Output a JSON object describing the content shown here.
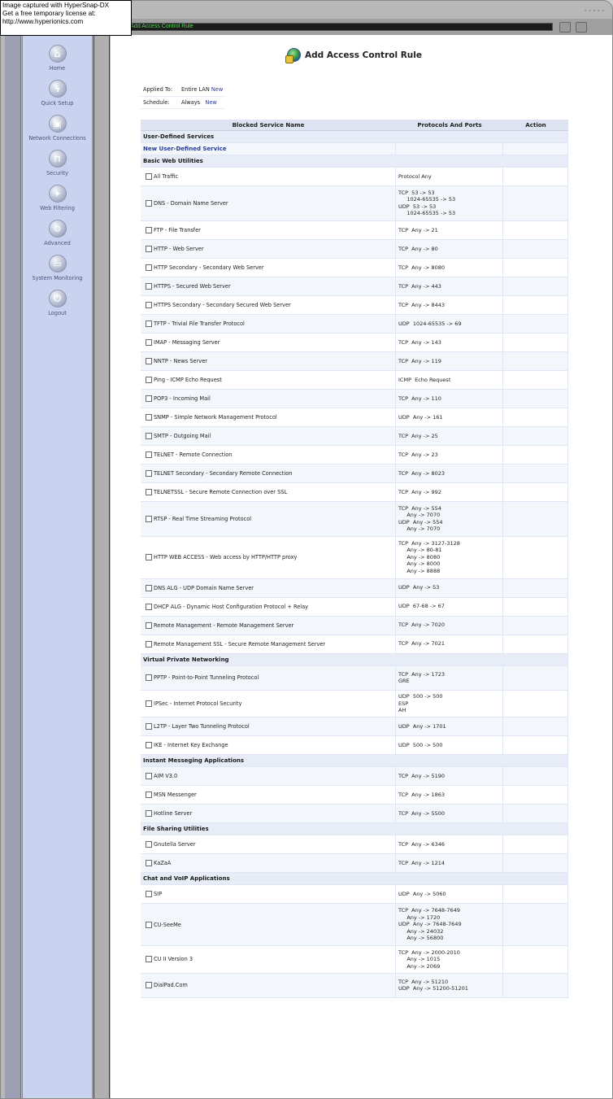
{
  "watermark": [
    "Image captured with HyperSnap-DX",
    "Get a free temporary license at:",
    "http://www.hyperionics.com"
  ],
  "breadcrumb": "rity -> Add Access Control Rule",
  "sidebar": [
    {
      "label": "Home",
      "icon": "home-icon"
    },
    {
      "label": "Quick Setup",
      "icon": "lightning-icon"
    },
    {
      "label": "Network Connections",
      "icon": "network-icon"
    },
    {
      "label": "Security",
      "icon": "lock-icon"
    },
    {
      "label": "Web Filtering",
      "icon": "filter-icon"
    },
    {
      "label": "Advanced",
      "icon": "gear-icon"
    },
    {
      "label": "System Monitoring",
      "icon": "monitor-icon"
    },
    {
      "label": "Logout",
      "icon": "logout-icon"
    }
  ],
  "page_title": "Add Access Control Rule",
  "meta": {
    "applied_to_label": "Applied To:",
    "applied_to_value": "Entire LAN",
    "schedule_label": "Schedule:",
    "schedule_value": "Always",
    "new_link": "New"
  },
  "table": {
    "headers": [
      "Blocked Service Name",
      "Protocols And Ports",
      "Action"
    ],
    "sections": [
      {
        "title": "User-Defined Services",
        "rows": [],
        "link": "New User-Defined Service"
      },
      {
        "title": "Basic Web Utilities",
        "rows": [
          {
            "name": "All Traffic",
            "proto": [
              "Protocol Any"
            ]
          },
          {
            "name": "DNS - Domain Name Server",
            "proto": [
              "TCP  53 -> 53",
              "     1024-65535 -> 53",
              "UDP  53 -> 53",
              "     1024-65535 -> 53"
            ]
          },
          {
            "name": "FTP - File Transfer",
            "proto": [
              "TCP  Any -> 21"
            ]
          },
          {
            "name": "HTTP - Web Server",
            "proto": [
              "TCP  Any -> 80"
            ]
          },
          {
            "name": "HTTP Secondary - Secondary Web Server",
            "proto": [
              "TCP  Any -> 8080"
            ]
          },
          {
            "name": "HTTPS - Secured Web Server",
            "proto": [
              "TCP  Any -> 443"
            ]
          },
          {
            "name": "HTTPS Secondary - Secondary Secured Web Server",
            "proto": [
              "TCP  Any -> 8443"
            ]
          },
          {
            "name": "TFTP - Trivial File Transfer Protocol",
            "proto": [
              "UDP  1024-65535 -> 69"
            ]
          },
          {
            "name": "IMAP - Messaging Server",
            "proto": [
              "TCP  Any -> 143"
            ]
          },
          {
            "name": "NNTP - News Server",
            "proto": [
              "TCP  Any -> 119"
            ]
          },
          {
            "name": "Ping - ICMP Echo Request",
            "proto": [
              "ICMP  Echo Request"
            ]
          },
          {
            "name": "POP3 - Incoming Mail",
            "proto": [
              "TCP  Any -> 110"
            ]
          },
          {
            "name": "SNMP - Simple Network Management Protocol",
            "proto": [
              "UDP  Any -> 161"
            ]
          },
          {
            "name": "SMTP - Outgoing Mail",
            "proto": [
              "TCP  Any -> 25"
            ]
          },
          {
            "name": "TELNET - Remote Connection",
            "proto": [
              "TCP  Any -> 23"
            ]
          },
          {
            "name": "TELNET Secondary - Secondary Remote Connection",
            "proto": [
              "TCP  Any -> 8023"
            ]
          },
          {
            "name": "TELNETSSL - Secure Remote Connection over SSL",
            "proto": [
              "TCP  Any -> 992"
            ]
          },
          {
            "name": "RTSP - Real Time Streaming Protocol",
            "proto": [
              "TCP  Any -> 554",
              "     Any -> 7070",
              "UDP  Any -> 554",
              "     Any -> 7070"
            ]
          },
          {
            "name": "HTTP WEB ACCESS - Web access by HTTP/HTTP proxy",
            "proto": [
              "TCP  Any -> 3127-3128",
              "     Any -> 80-81",
              "     Any -> 8080",
              "     Any -> 8000",
              "     Any -> 8888"
            ]
          },
          {
            "name": "DNS ALG - UDP Domain Name Server",
            "proto": [
              "UDP  Any -> 53"
            ]
          },
          {
            "name": "DHCP ALG - Dynamic Host Configuration Protocol + Relay",
            "proto": [
              "UDP  67-68 -> 67"
            ]
          },
          {
            "name": "Remote Management - Remote Management Server",
            "proto": [
              "TCP  Any -> 7020"
            ]
          },
          {
            "name": "Remote Management SSL - Secure Remote Management Server",
            "proto": [
              "TCP  Any -> 7021"
            ]
          }
        ]
      },
      {
        "title": "Virtual Private Networking",
        "rows": [
          {
            "name": "PPTP - Point-to-Point Tunneling Protocol",
            "proto": [
              "TCP  Any -> 1723",
              "GRE"
            ]
          },
          {
            "name": "IPSec - Internet Protocol Security",
            "proto": [
              "UDP  500 -> 500",
              "ESP",
              "AH"
            ]
          },
          {
            "name": "L2TP - Layer Two Tunneling Protocol",
            "proto": [
              "UDP  Any -> 1701"
            ]
          },
          {
            "name": "IKE - Internet Key Exchange",
            "proto": [
              "UDP  500 -> 500"
            ]
          }
        ]
      },
      {
        "title": "Instant Messeging Applications",
        "rows": [
          {
            "name": "AIM V3.0",
            "proto": [
              "TCP  Any -> 5190"
            ]
          },
          {
            "name": "MSN Messenger",
            "proto": [
              "TCP  Any -> 1863"
            ]
          },
          {
            "name": "Hotline Server",
            "proto": [
              "TCP  Any -> 5500"
            ]
          }
        ]
      },
      {
        "title": "File Sharing Utilities",
        "rows": [
          {
            "name": "Gnutella Server",
            "proto": [
              "TCP  Any -> 6346"
            ]
          },
          {
            "name": "KaZaA",
            "proto": [
              "TCP  Any -> 1214"
            ]
          }
        ]
      },
      {
        "title": "Chat and VoIP Applications",
        "rows": [
          {
            "name": "SIP",
            "proto": [
              "UDP  Any -> 5060"
            ]
          },
          {
            "name": "CU-SeeMe",
            "proto": [
              "TCP  Any -> 7648-7649",
              "     Any -> 1720",
              "UDP  Any -> 7648-7649",
              "     Any -> 24032",
              "     Any -> 56800"
            ]
          },
          {
            "name": "CU II Version 3",
            "proto": [
              "TCP  Any -> 2000-2010",
              "     Any -> 1015",
              "     Any -> 2069"
            ]
          },
          {
            "name": "DialPad.Com",
            "proto": [
              "TCP  Any -> 51210",
              "UDP  Any -> 51200-51201"
            ]
          }
        ]
      }
    ]
  }
}
